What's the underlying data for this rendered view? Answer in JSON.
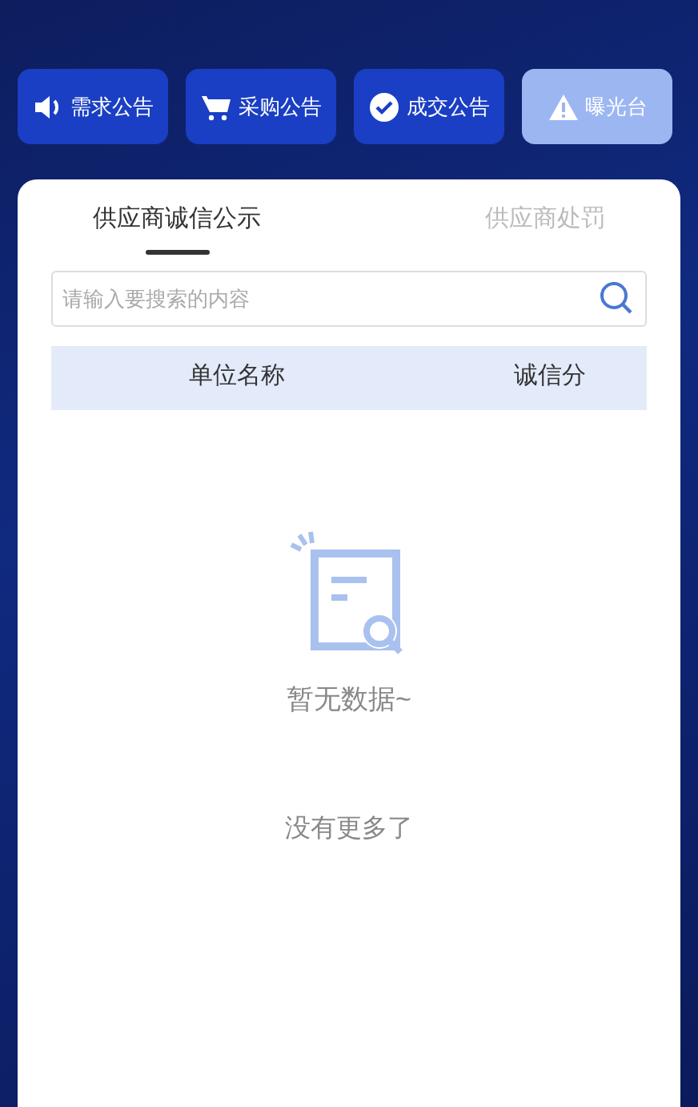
{
  "categories": [
    {
      "kind": "speaker",
      "label": "需求公告",
      "selected": false
    },
    {
      "kind": "cart",
      "label": "采购公告",
      "selected": false
    },
    {
      "kind": "check",
      "label": "成交公告",
      "selected": false
    },
    {
      "kind": "warning",
      "label": "曝光台",
      "selected": true
    }
  ],
  "tabs": [
    {
      "label": "供应商诚信公示",
      "selected": true
    },
    {
      "label": "供应商处罚",
      "selected": false
    }
  ],
  "search": {
    "placeholder": "请输入要搜索的内容"
  },
  "table": {
    "columns": [
      "单位名称",
      "诚信分"
    ]
  },
  "empty_state": {
    "message": "暂无数据~"
  },
  "footer_note": "没有更多了"
}
